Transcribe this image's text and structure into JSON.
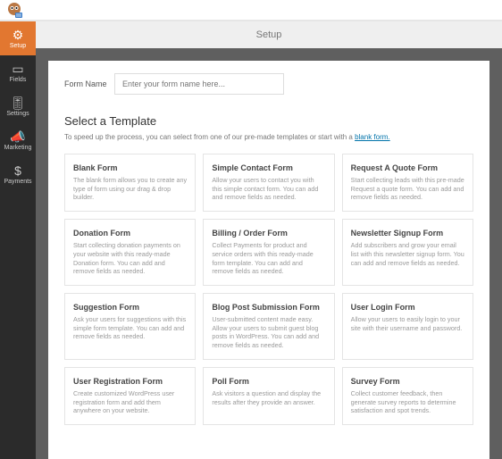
{
  "header": {
    "setup": "Setup"
  },
  "sidebar": {
    "items": [
      {
        "label": "Setup",
        "icon": "⚙"
      },
      {
        "label": "Fields",
        "icon": "▭"
      },
      {
        "label": "Settings",
        "icon": "🎚"
      },
      {
        "label": "Marketing",
        "icon": "📣"
      },
      {
        "label": "Payments",
        "icon": "$"
      }
    ]
  },
  "form": {
    "name_label": "Form Name",
    "name_placeholder": "Enter your form name here..."
  },
  "templates": {
    "title": "Select a Template",
    "hint_pre": "To speed up the process, you can select from one of our pre-made templates or start with a ",
    "hint_link": "blank form.",
    "cards": [
      {
        "title": "Blank Form",
        "desc": "The blank form allows you to create any type of form using our drag & drop builder."
      },
      {
        "title": "Simple Contact Form",
        "desc": "Allow your users to contact you with this simple contact form. You can add and remove fields as needed."
      },
      {
        "title": "Request A Quote Form",
        "desc": "Start collecting leads with this pre-made Request a quote form. You can add and remove fields as needed."
      },
      {
        "title": "Donation Form",
        "desc": "Start collecting donation payments on your website with this ready-made Donation form. You can add and remove fields as needed."
      },
      {
        "title": "Billing / Order Form",
        "desc": "Collect Payments for product and service orders with this ready-made form template. You can add and remove fields as needed."
      },
      {
        "title": "Newsletter Signup Form",
        "desc": "Add subscribers and grow your email list with this newsletter signup form. You can add and remove fields as needed."
      },
      {
        "title": "Suggestion Form",
        "desc": "Ask your users for suggestions with this simple form template. You can add and remove fields as needed."
      },
      {
        "title": "Blog Post Submission Form",
        "desc": "User-submitted content made easy. Allow your users to submit guest blog posts in WordPress. You can add and remove fields as needed."
      },
      {
        "title": "User Login Form",
        "desc": "Allow your users to easily login to your site with their username and password."
      },
      {
        "title": "User Registration Form",
        "desc": "Create customized WordPress user registration form and add them anywhere on your website."
      },
      {
        "title": "Poll Form",
        "desc": "Ask visitors a question and display the results after they provide an answer."
      },
      {
        "title": "Survey Form",
        "desc": "Collect customer feedback, then generate survey reports to determine satisfaction and spot trends."
      }
    ]
  }
}
